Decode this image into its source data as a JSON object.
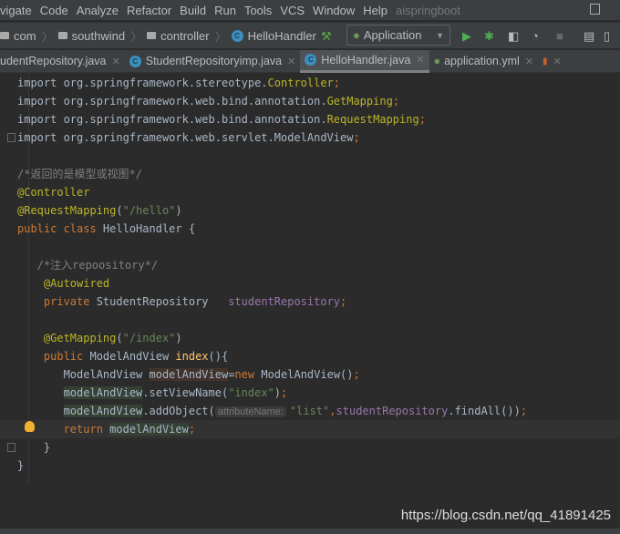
{
  "menu": {
    "items": [
      "vigate",
      "Code",
      "Analyze",
      "Refactor",
      "Build",
      "Run",
      "Tools",
      "VCS",
      "Window",
      "Help"
    ],
    "project": "aispringboot"
  },
  "breadcrumb": {
    "items": [
      "com",
      "southwind",
      "controller",
      "HelloHandler"
    ]
  },
  "run_config": {
    "selected": "Application"
  },
  "tabs": [
    {
      "label": "udentRepository.java"
    },
    {
      "label": "StudentRepositoryimp.java"
    },
    {
      "label": "HelloHandler.java",
      "active": true
    },
    {
      "label": "application.yml"
    }
  ],
  "code": {
    "lines": [
      [
        [
          "import org.springframework.stereotype.",
          ""
        ],
        [
          "Controller",
          "ann"
        ],
        [
          ";",
          "kw"
        ]
      ],
      [
        [
          "import org.springframework.web.bind.annotation.",
          ""
        ],
        [
          "GetMapping",
          "ann"
        ],
        [
          ";",
          "kw"
        ]
      ],
      [
        [
          "import org.springframework.web.bind.annotation.",
          ""
        ],
        [
          "RequestMapping",
          "ann"
        ],
        [
          ";",
          "kw"
        ]
      ],
      [
        [
          "import org.springframework.web.servlet.ModelAndView",
          ""
        ],
        [
          ";",
          "kw"
        ]
      ],
      [],
      [
        [
          "/*返回的是模型或视图*/",
          "cm"
        ]
      ],
      [
        [
          "@Controller",
          "ann"
        ]
      ],
      [
        [
          "@RequestMapping",
          "ann"
        ],
        [
          "(",
          ""
        ],
        [
          "\"/hello\"",
          "str"
        ],
        [
          ")",
          ""
        ]
      ],
      [
        [
          "public class ",
          "kw"
        ],
        [
          "HelloHandler {",
          ""
        ]
      ],
      [],
      [
        [
          "   /*注入repoository*/",
          "cm"
        ]
      ],
      [
        [
          "    ",
          ""
        ],
        [
          "@Autowired",
          "ann"
        ]
      ],
      [
        [
          "    ",
          ""
        ],
        [
          "private ",
          "kw"
        ],
        [
          "StudentRepository   ",
          ""
        ],
        [
          "studentRepository",
          "fld"
        ],
        [
          ";",
          "kw"
        ]
      ],
      [],
      [
        [
          "    ",
          ""
        ],
        [
          "@GetMapping",
          "ann"
        ],
        [
          "(",
          ""
        ],
        [
          "\"/index\"",
          "str"
        ],
        [
          ")",
          ""
        ]
      ],
      [
        [
          "    ",
          ""
        ],
        [
          "public ",
          "kw"
        ],
        [
          "ModelAndView ",
          ""
        ],
        [
          "index",
          "fn"
        ],
        [
          "(){",
          ""
        ]
      ],
      [
        [
          "       ModelAndView ",
          ""
        ],
        [
          "modelAndView",
          "hlw"
        ],
        [
          "=",
          ""
        ],
        [
          "new ",
          "kw"
        ],
        [
          "ModelAndView()",
          ""
        ],
        [
          ";",
          "kw"
        ]
      ],
      [
        [
          "       ",
          ""
        ],
        [
          "modelAndView",
          "hl"
        ],
        [
          ".setViewName(",
          ""
        ],
        [
          "\"index\"",
          "str"
        ],
        [
          ")",
          ""
        ],
        [
          ";",
          "kw"
        ]
      ],
      [
        [
          "       ",
          ""
        ],
        [
          "modelAndView",
          "hl"
        ],
        [
          ".addObject(",
          ""
        ],
        [
          "attributeName:",
          "hint"
        ],
        [
          "\"list\"",
          "str"
        ],
        [
          ",",
          "kw"
        ],
        [
          "studentRepository",
          "fld"
        ],
        [
          ".findAll())",
          ""
        ],
        [
          ";",
          "kw"
        ]
      ],
      [
        [
          "       ",
          ""
        ],
        [
          "return ",
          "kw"
        ],
        [
          "modelAndView",
          "hl"
        ],
        [
          ";",
          "kw"
        ]
      ],
      [
        [
          "    }",
          ""
        ]
      ],
      [
        [
          "}",
          ""
        ]
      ]
    ]
  },
  "watermark": "https://blog.csdn.net/qq_41891425"
}
